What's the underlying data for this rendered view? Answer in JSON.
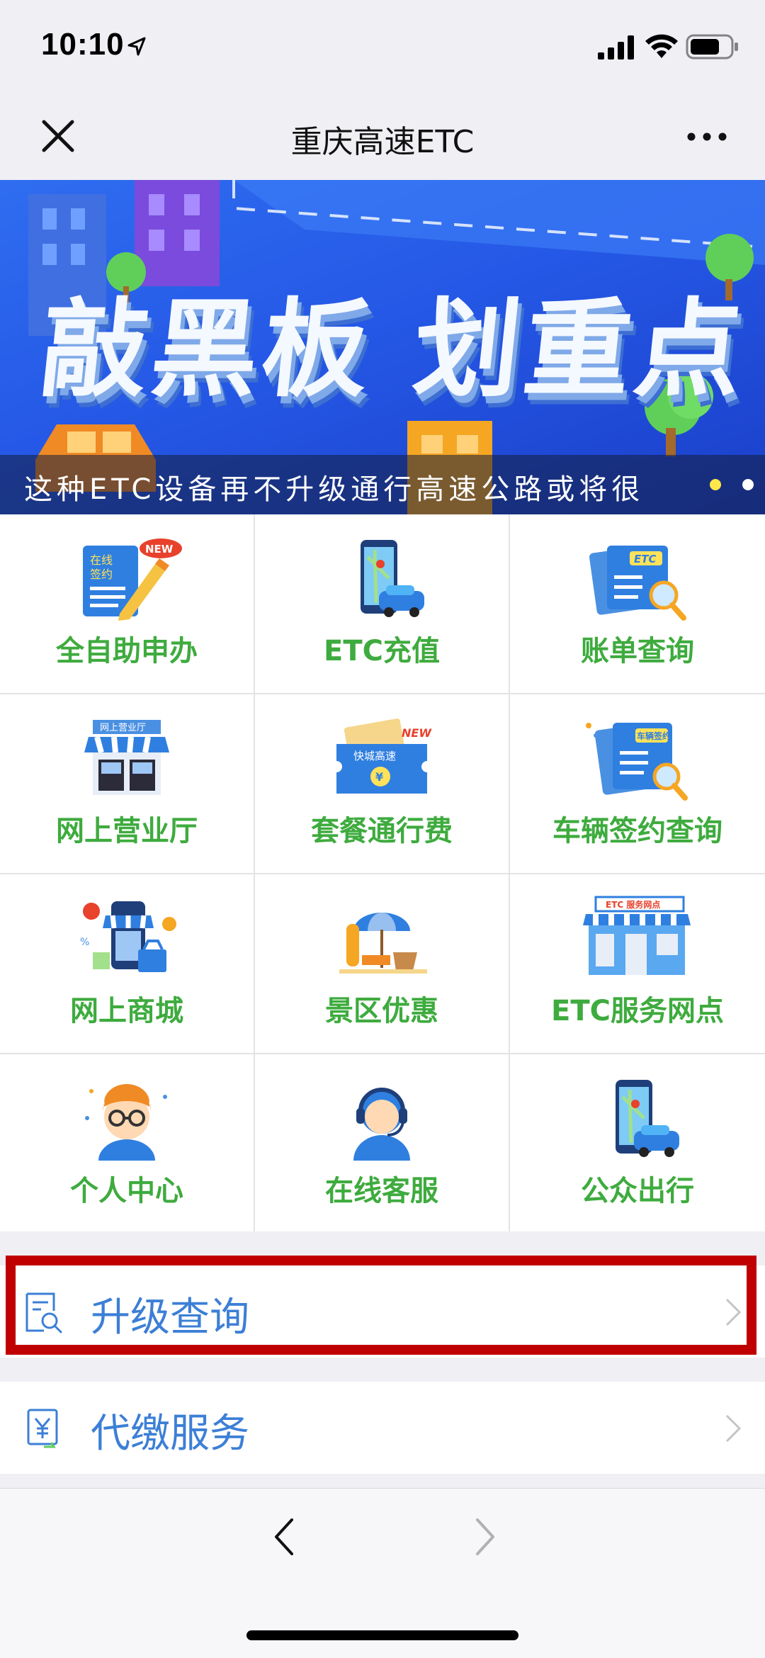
{
  "status_bar": {
    "time": "10:10"
  },
  "nav": {
    "title": "重庆高速ETC"
  },
  "banner": {
    "headline": "敲黑板 划重点",
    "caption": "这种ETC设备再不升级通行高速公路或将很",
    "slide_count": 2,
    "active_slide": 1
  },
  "grid": {
    "items": [
      {
        "label": "全自助申办",
        "icon": "self-service-apply-icon"
      },
      {
        "label": "ETC充值",
        "icon": "etc-recharge-icon"
      },
      {
        "label": "账单查询",
        "icon": "bill-query-icon"
      },
      {
        "label": "网上营业厅",
        "icon": "online-hall-icon"
      },
      {
        "label": "套餐通行费",
        "icon": "toll-package-icon"
      },
      {
        "label": "车辆签约查询",
        "icon": "vehicle-contract-icon"
      },
      {
        "label": "网上商城",
        "icon": "online-mall-icon"
      },
      {
        "label": "景区优惠",
        "icon": "scenic-discount-icon"
      },
      {
        "label": "ETC服务网点",
        "icon": "service-outlet-icon"
      },
      {
        "label": "个人中心",
        "icon": "personal-center-icon"
      },
      {
        "label": "在线客服",
        "icon": "customer-service-icon"
      },
      {
        "label": "公众出行",
        "icon": "public-travel-icon"
      }
    ],
    "icon_text": {
      "sign": "在线\n签约",
      "new": "NEW",
      "etc": "ETC",
      "hall": "网上营业厅",
      "toll": "快城高速",
      "contract": "车辆签约",
      "outlet": "ETC 服务网点"
    }
  },
  "list": {
    "upgrade_label": "升级查询",
    "payment_label": "代缴服务"
  },
  "colors": {
    "grid_label": "#3eab3e",
    "list_label": "#3c7fd6",
    "highlight": "#c00000",
    "banner": "#2558e6"
  }
}
